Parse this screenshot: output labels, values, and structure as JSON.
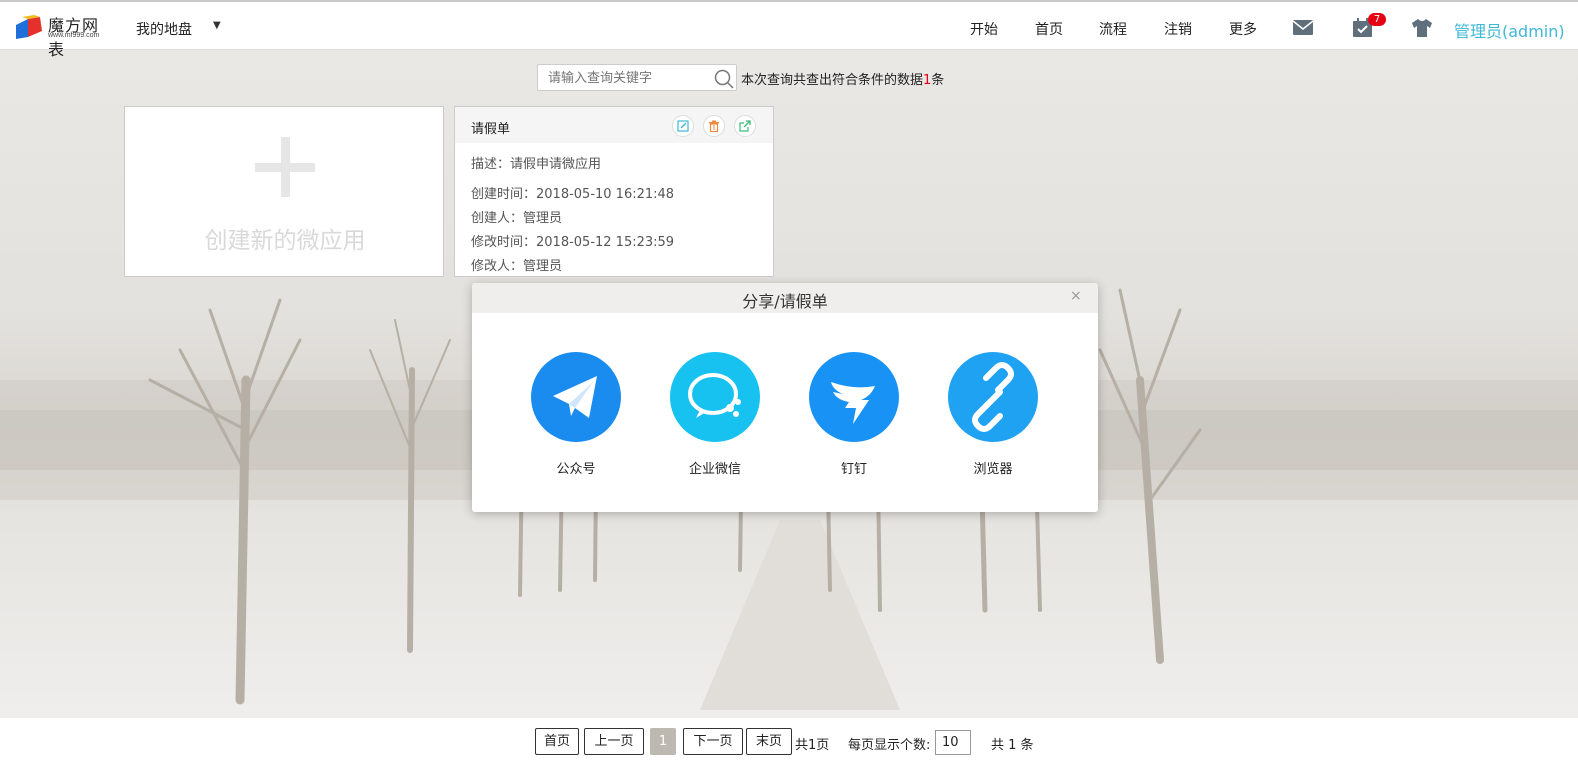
{
  "header": {
    "logo_name": "魔方网表",
    "logo_url": "www.mf999.com",
    "disk_label": "我的地盘",
    "nav": [
      "开始",
      "首页",
      "流程",
      "注销",
      "更多"
    ],
    "task_badge": "7",
    "user": "管理员(admin)"
  },
  "search": {
    "placeholder": "请输入查询关键字",
    "result_prefix": "本次查询共查出符合条件的数据",
    "result_count": "1",
    "result_suffix": "条"
  },
  "new_card": {
    "label": "创建新的微应用"
  },
  "app_card": {
    "title": "请假单",
    "description": "描述：请假申请微应用",
    "created_time": "创建时间：2018-05-10 16:21:48",
    "creator": "创建人：管理员",
    "modified_time": "修改时间：2018-05-12 15:23:59",
    "modifier": "修改人：管理员"
  },
  "share_dialog": {
    "title": "分享/请假单",
    "close": "×",
    "options": [
      {
        "label": "公众号",
        "icon": "paper-plane-icon",
        "color": "#1a8cf0"
      },
      {
        "label": "企业微信",
        "icon": "wecom-chat-icon",
        "color": "#18c2f0"
      },
      {
        "label": "钉钉",
        "icon": "dingtalk-icon",
        "color": "#1992f5"
      },
      {
        "label": "浏览器",
        "icon": "link-icon",
        "color": "#20a2f3"
      }
    ]
  },
  "pagination": {
    "first": "首页",
    "prev": "上一页",
    "current": "1",
    "next": "下一页",
    "last": "末页",
    "total_pages": "共1页",
    "page_size_label": "每页显示个数:",
    "page_size": "10",
    "total_records": "共 1 条"
  }
}
